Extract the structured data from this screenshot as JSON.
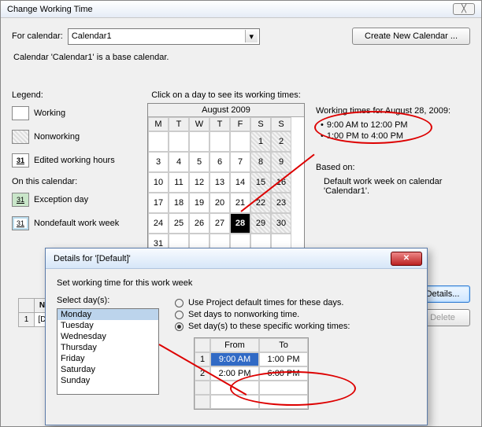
{
  "window": {
    "title": "Change Working Time",
    "close_glyph": "╳"
  },
  "top": {
    "for_calendar_label": "For calendar:",
    "calendar_selected": "Calendar1",
    "create_new_label": "Create New Calendar ..."
  },
  "base_info": "Calendar 'Calendar1' is a base calendar.",
  "legend": {
    "title": "Legend:",
    "items": [
      {
        "label": "Working",
        "kind": "working"
      },
      {
        "label": "Nonworking",
        "kind": "nonworking"
      },
      {
        "label": "Edited working hours",
        "kind": "edited",
        "glyph": "31"
      }
    ],
    "subhead": "On this calendar:",
    "items2": [
      {
        "label": "Exception day",
        "kind": "exc",
        "glyph": "31"
      },
      {
        "label": "Nondefault work week",
        "kind": "nondef",
        "glyph": "31"
      }
    ]
  },
  "calendar": {
    "caption": "Click on a day to see its working times:",
    "month_title": "August 2009",
    "headers": [
      "M",
      "T",
      "W",
      "T",
      "F",
      "S",
      "S"
    ],
    "weeks": [
      [
        "",
        "",
        "",
        "",
        "",
        "1",
        "2"
      ],
      [
        "3",
        "4",
        "5",
        "6",
        "7",
        "8",
        "9"
      ],
      [
        "10",
        "11",
        "12",
        "13",
        "14",
        "15",
        "16"
      ],
      [
        "17",
        "18",
        "19",
        "20",
        "21",
        "22",
        "23"
      ],
      [
        "24",
        "25",
        "26",
        "27",
        "28",
        "29",
        "30"
      ],
      [
        "31",
        "",
        "",
        "",
        "",
        "",
        ""
      ]
    ],
    "selected_day": "28"
  },
  "right": {
    "heading": "Working times for August 28, 2009:",
    "times": [
      "9:00 AM to 12:00 PM",
      "1:00 PM to 4:00 PM"
    ],
    "based_label": "Based on:",
    "based_text1": "Default work week on calendar",
    "based_text2": "'Calendar1'."
  },
  "side_buttons": {
    "details": "Details...",
    "delete": "Delete"
  },
  "stub": {
    "col_n": "N",
    "row1": "1",
    "cell": "[D"
  },
  "dlg2": {
    "title": "Details for '[Default]'",
    "close_glyph": "✕",
    "instruction": "Set working time for this work week",
    "select_days_label": "Select day(s):",
    "days": [
      "Monday",
      "Tuesday",
      "Wednesday",
      "Thursday",
      "Friday",
      "Saturday",
      "Sunday"
    ],
    "selected_day_index": 0,
    "radios": {
      "r1": "Use Project default times for these days.",
      "r2": "Set days to nonworking time.",
      "r3": "Set day(s) to these specific working times:"
    },
    "selected_radio": 3,
    "time_headers": {
      "from": "From",
      "to": "To"
    },
    "time_rows": [
      {
        "n": "1",
        "from": "9:00 AM",
        "to": "1:00 PM"
      },
      {
        "n": "2",
        "from": "2:00 PM",
        "to": "6:00 PM"
      }
    ]
  }
}
